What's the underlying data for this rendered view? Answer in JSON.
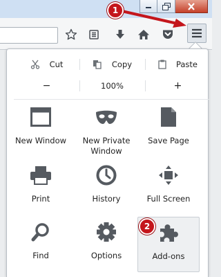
{
  "edit": {
    "cut_label": "Cut",
    "copy_label": "Copy",
    "paste_label": "Paste"
  },
  "zoom": {
    "out_label": "−",
    "level": "100%",
    "in_label": "+"
  },
  "items": [
    {
      "label": "New Window",
      "icon": "window-icon"
    },
    {
      "label": "New Private\nWindow",
      "icon": "mask-icon"
    },
    {
      "label": "Save Page",
      "icon": "page-icon"
    },
    {
      "label": "Print",
      "icon": "printer-icon"
    },
    {
      "label": "History",
      "icon": "clock-icon"
    },
    {
      "label": "Full Screen",
      "icon": "fullscreen-icon"
    },
    {
      "label": "Find",
      "icon": "magnifier-icon"
    },
    {
      "label": "Options",
      "icon": "gear-icon"
    },
    {
      "label": "Add-ons",
      "icon": "puzzle-icon"
    }
  ],
  "annotations": {
    "step1": "1",
    "step2": "2"
  },
  "colors": {
    "callout_red": "#c4161c",
    "icon_gray": "#555a60"
  }
}
